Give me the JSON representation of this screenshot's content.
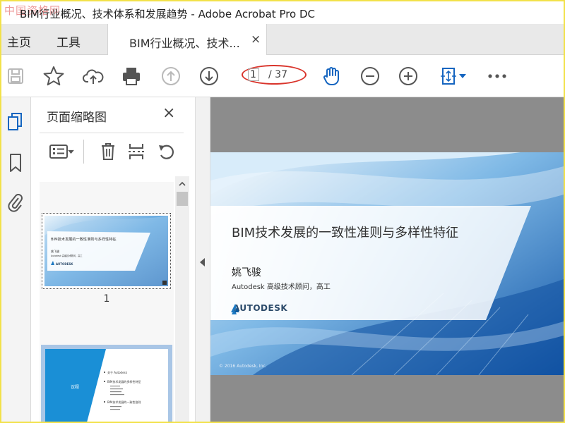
{
  "window": {
    "watermark": "中国资格网",
    "title": "BIM行业概况、技术体系和发展趋势 - Adobe Acrobat Pro DC"
  },
  "nav": {
    "home": "主页",
    "tools": "工具",
    "doc_tab": "BIM行业概况、技术...",
    "close": "×"
  },
  "toolbar": {
    "current_page": "1",
    "total_pages": "/ 37",
    "annotation_color": "#d9342b"
  },
  "panel": {
    "title": "页面缩略图",
    "close": "×",
    "thumb1_label": "1"
  },
  "thumb1": {
    "title": "BIM技术发展的一致性准则与多样性特征",
    "author": "姚飞骏",
    "role": "Autodesk 高级技术顾问，高工",
    "logo": "AUTODESK"
  },
  "thumb2": {
    "heading": "议程",
    "items": [
      "关于 Autodesk",
      "BIM技术发展的多样性特征",
      "BIM技术发展的一致性准则"
    ]
  },
  "slide": {
    "title": "BIM技术发展的一致性准则与多样性特征",
    "author": "姚飞骏",
    "role": "Autodesk 高级技术顾问，高工",
    "logo": "AUTODESK",
    "copyright": "© 2016 Autodesk, Inc."
  },
  "colors": {
    "accent_blue": "#1565c0",
    "toolbar_icon": "#555555",
    "disabled_icon": "#b9b9b9"
  }
}
